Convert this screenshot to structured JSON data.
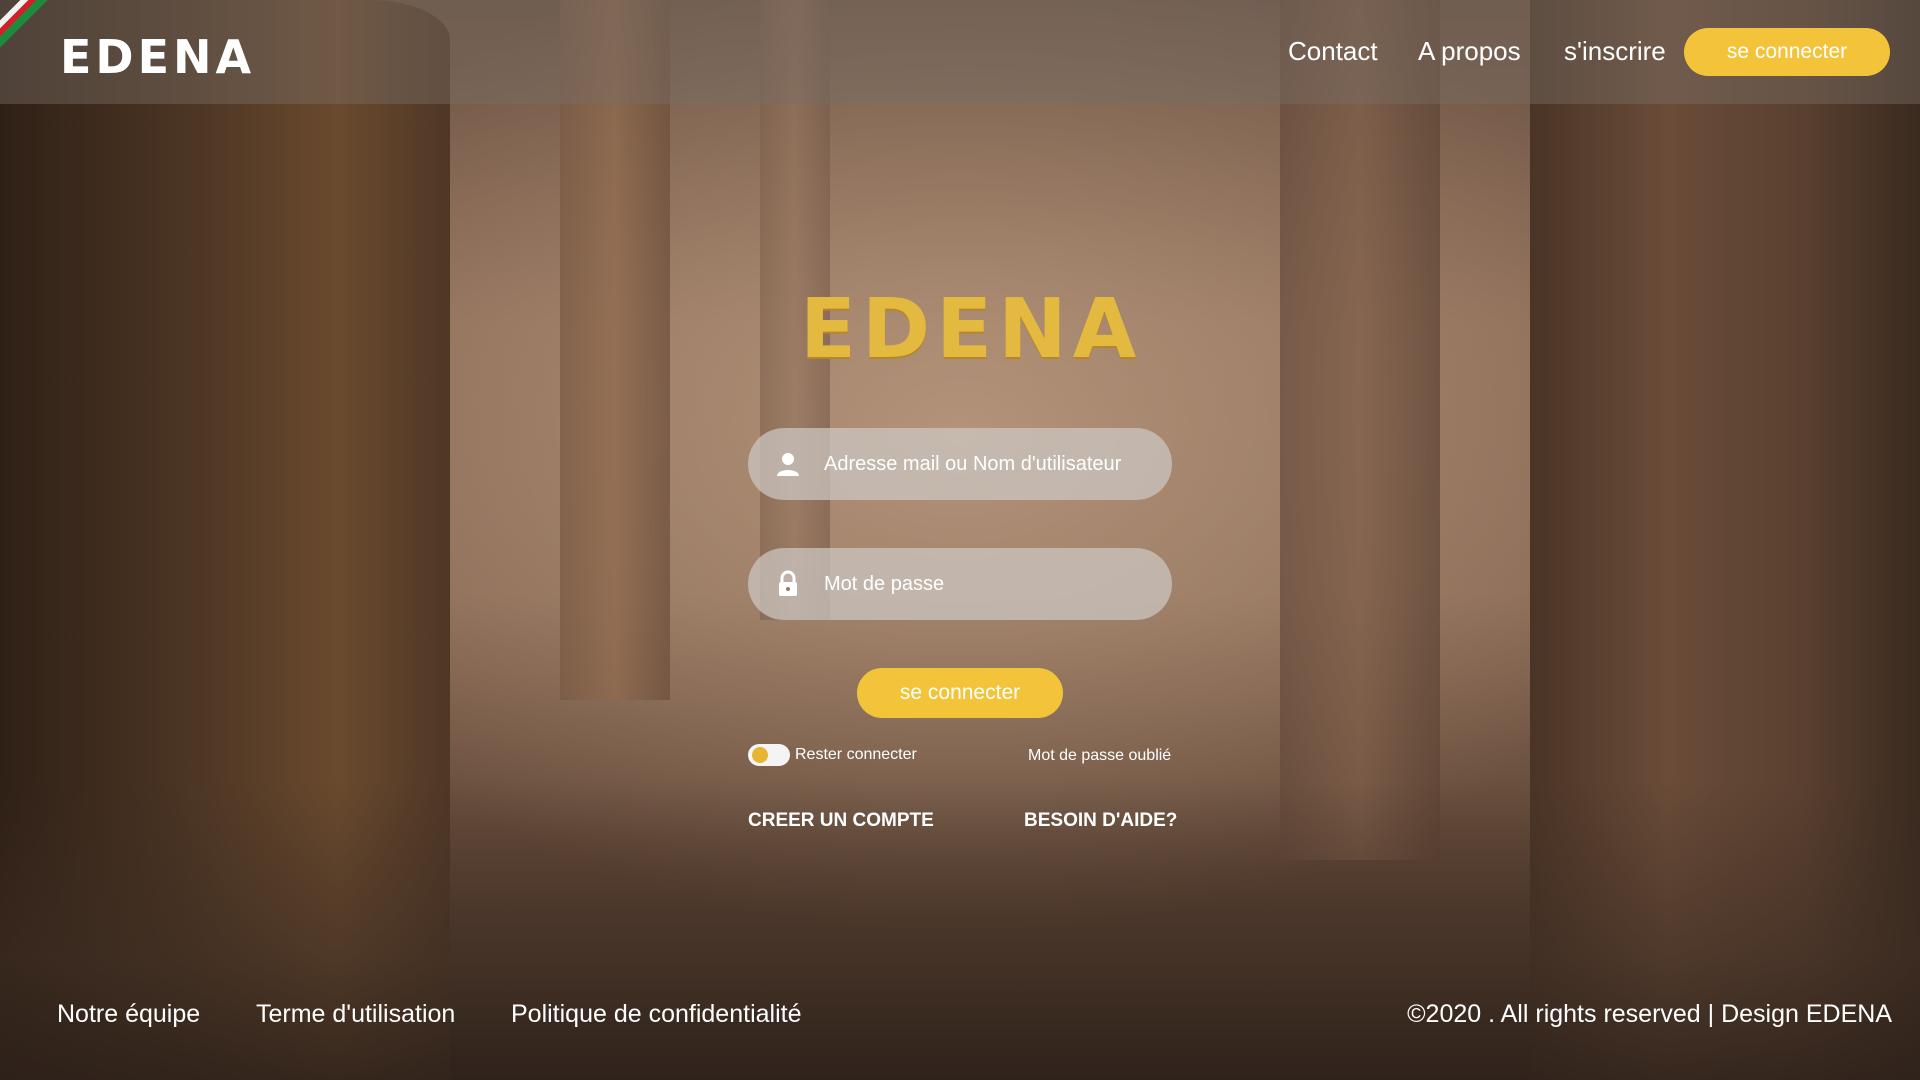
{
  "header": {
    "brand": "EDENA",
    "nav": {
      "contact": "Contact",
      "apropos": "A propos",
      "inscrire": "s'inscrire"
    },
    "login_button": "se connecter"
  },
  "main": {
    "logo": "EDENA",
    "email_placeholder": "Adresse mail ou Nom d'utilisateur",
    "password_placeholder": "Mot de passe",
    "login_button": "se connecter",
    "remember_label": "Rester connecter",
    "forgot_label": "Mot de passe oublié",
    "create_account": "CREER  UN COMPTE",
    "help": "BESOIN D'AIDE?"
  },
  "footer": {
    "team": "Notre équipe",
    "terms": "Terme d'utilisation",
    "privacy": "Politique de confidentialité",
    "copyright": "©2020 .  All rights reserved | Design EDENA"
  },
  "icons": {
    "email_field": "user-icon",
    "password_field": "lock-icon"
  },
  "colors": {
    "accent": "#f3c43a",
    "logo_gold": "#e3b93f"
  },
  "states": {
    "remember_toggle_on": false
  }
}
